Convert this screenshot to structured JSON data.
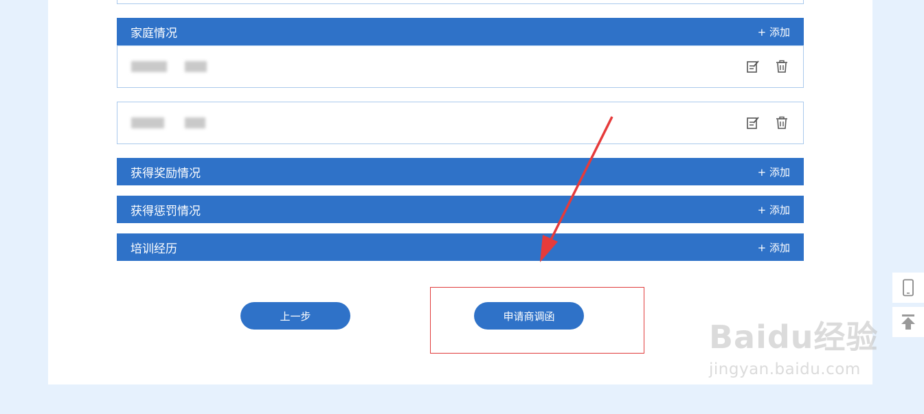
{
  "sections": {
    "family": {
      "title": "家庭情况",
      "add_label": "+ 添加"
    },
    "rewards": {
      "title": "获得奖励情况",
      "add_label": "+ 添加"
    },
    "punishments": {
      "title": "获得惩罚情况",
      "add_label": "+ 添加"
    },
    "training": {
      "title": "培训经历",
      "add_label": "+ 添加"
    }
  },
  "buttons": {
    "prev_label": "上一步",
    "apply_label": "申请商调函"
  },
  "watermark": {
    "main": "Baidu经验",
    "sub": "jingyan.baidu.com"
  },
  "colors": {
    "header_bg": "#2f72c8",
    "page_bg": "#e6f1fd",
    "highlight": "#e03a3a"
  },
  "icons": [
    "edit-icon",
    "trash-icon",
    "mobile-icon",
    "back-to-top-icon"
  ]
}
